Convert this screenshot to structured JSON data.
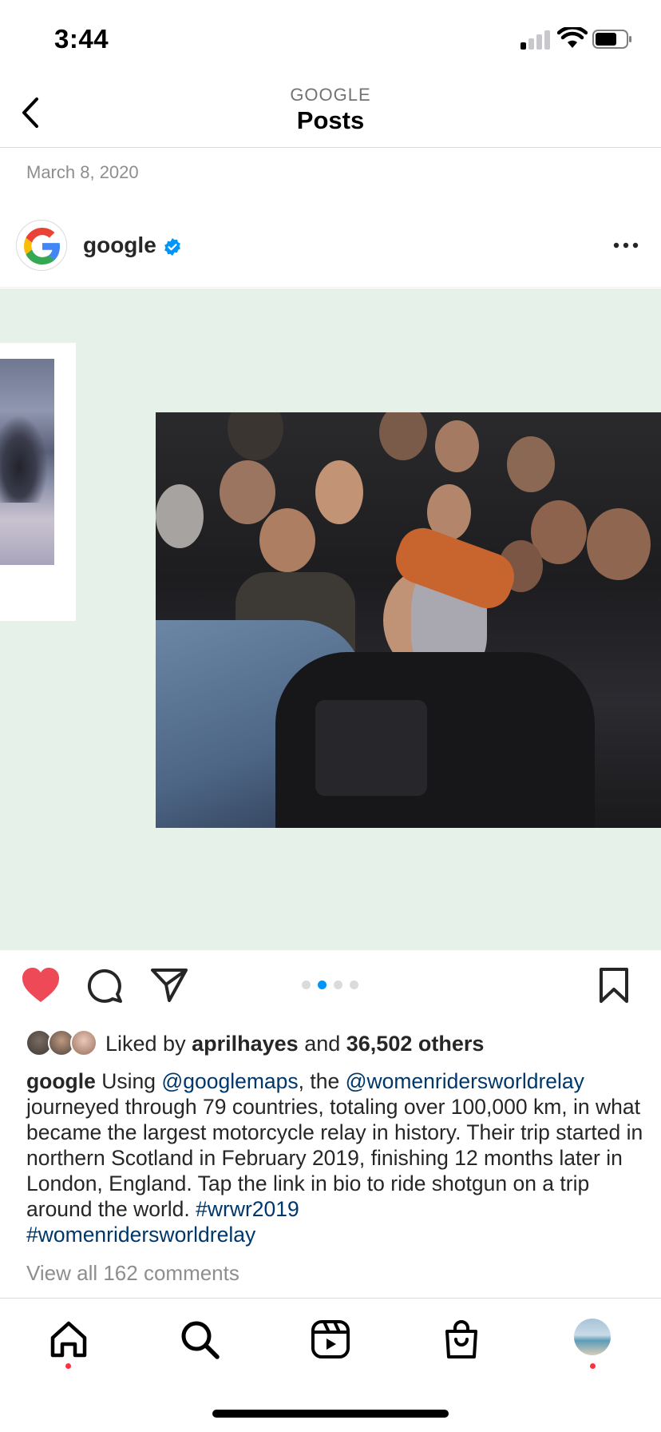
{
  "status_bar": {
    "time": "3:44"
  },
  "header": {
    "subtitle": "GOOGLE",
    "title": "Posts"
  },
  "post": {
    "date": "March 8, 2020",
    "username": "google",
    "verified": true,
    "carousel": {
      "count": 4,
      "active_index": 1
    },
    "liked_by": {
      "prefix": "Liked by",
      "user": "aprilhayes",
      "and": "and",
      "others": "36,502 others"
    },
    "caption": {
      "username": "google",
      "t1": " Using ",
      "mention1": "@googlemaps",
      "t2": ", the ",
      "mention2": "@womenridersworldrelay",
      "t3": " journeyed through 79 countries, totaling over 100,000 km, in what became the largest motorcycle relay in history. Their trip started in northern Scotland in February 2019, finishing 12 months later in London, England. Tap the link in bio to ride shotgun on a trip around the world. ",
      "hashtag1": "#wrwr2019",
      "hashtag2": "#womenridersworldrelay"
    },
    "view_comments": "View all 162 comments"
  },
  "colors": {
    "like_red": "#ed4956",
    "link_blue": "#00376b",
    "accent_blue": "#0095f6",
    "media_bg": "#e5f1e9"
  },
  "tab_bar": {
    "items": [
      "home-icon",
      "search-icon",
      "reels-icon",
      "shop-icon",
      "profile-avatar"
    ]
  }
}
